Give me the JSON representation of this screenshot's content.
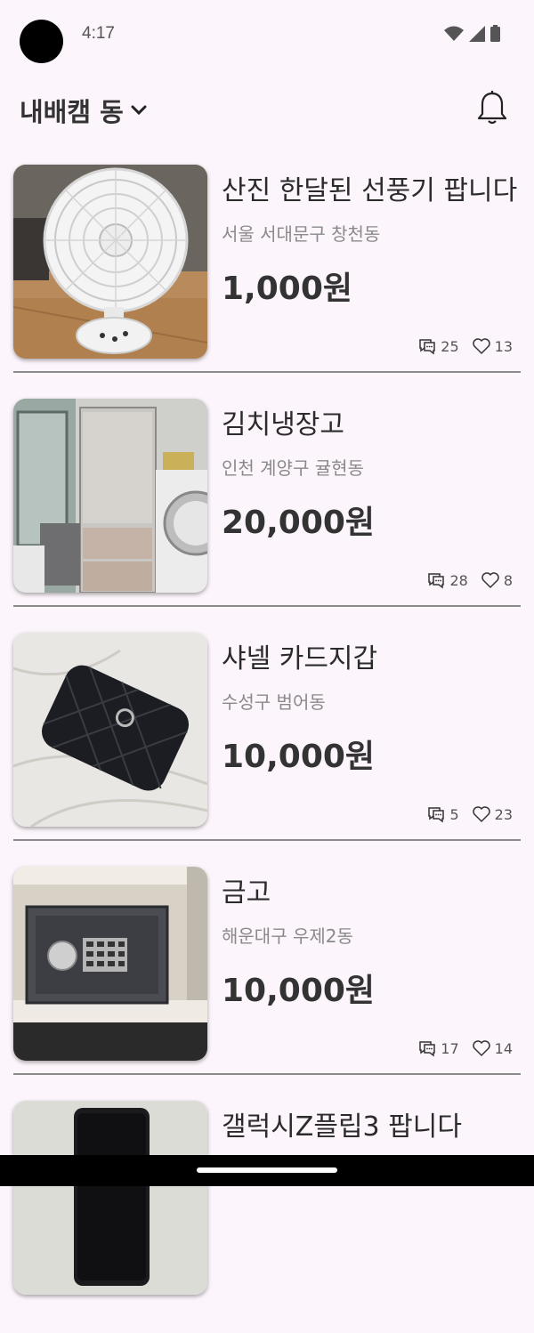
{
  "status": {
    "time": "4:17"
  },
  "header": {
    "location_label": "내배캠 동"
  },
  "items": [
    {
      "title": "산진 한달된 선풍기 팝니다",
      "location": "서울 서대문구 창천동",
      "price": "1,000원",
      "comments": "25",
      "likes": "13",
      "image": "electric-fan"
    },
    {
      "title": "김치냉장고",
      "location": "인천 계양구 귤현동",
      "price": "20,000원",
      "comments": "28",
      "likes": "8",
      "image": "kimchi-refrigerator"
    },
    {
      "title": "샤넬 카드지갑",
      "location": "수성구 범어동",
      "price": "10,000원",
      "comments": "5",
      "likes": "23",
      "image": "black-wallet"
    },
    {
      "title": "금고",
      "location": "해운대구 우제2동",
      "price": "10,000원",
      "comments": "17",
      "likes": "14",
      "image": "safe"
    },
    {
      "title": "갤럭시Z플립3 팝니다",
      "location": "",
      "price": "",
      "comments": "",
      "likes": "",
      "image": "phone"
    }
  ]
}
